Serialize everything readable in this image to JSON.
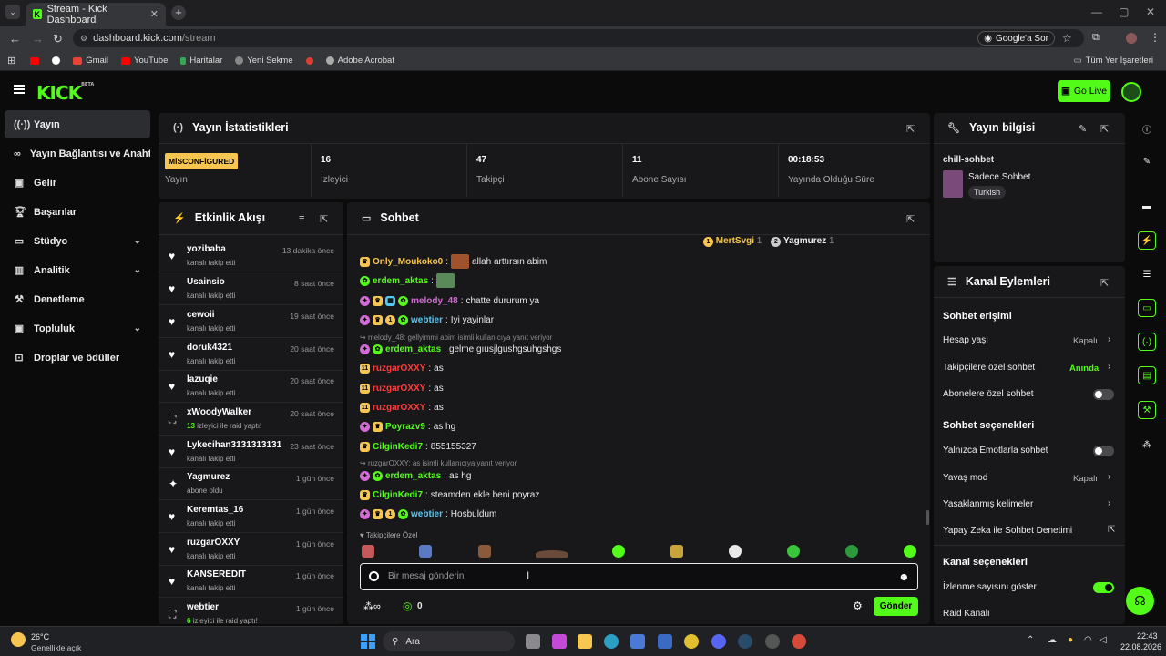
{
  "browser": {
    "tab_title": "Stream - Kick Dashboard",
    "url_host": "dashboard.kick.com",
    "url_path": "/stream",
    "google_sor": "Google'a Sor",
    "bookmarks": [
      "Gmail",
      "YouTube",
      "Haritalar",
      "Yeni Sekme",
      "Adobe Acrobat"
    ],
    "all_bookmarks": "Tüm Yer İşaretleri"
  },
  "header": {
    "logo": "KICK",
    "beta": "BETA",
    "go_live": "Go Live"
  },
  "sidebar": {
    "items": [
      {
        "label": "Yayın",
        "icon": "broadcast-icon"
      },
      {
        "label": "Yayın Bağlantısı ve Anahtarı",
        "icon": "link-icon"
      },
      {
        "label": "Gelir",
        "icon": "revenue-icon"
      },
      {
        "label": "Başarılar",
        "icon": "trophy-icon"
      },
      {
        "label": "Stüdyo",
        "icon": "studio-icon"
      },
      {
        "label": "Analitik",
        "icon": "analytics-icon"
      },
      {
        "label": "Denetleme",
        "icon": "moderation-icon"
      },
      {
        "label": "Topluluk",
        "icon": "community-icon"
      },
      {
        "label": "Droplar ve ödüller",
        "icon": "drops-icon"
      }
    ]
  },
  "stats": {
    "title": "Yayın İstatistikleri",
    "status_badge": "MİSCONFİGURED",
    "items": [
      {
        "label": "Yayın",
        "value": ""
      },
      {
        "label": "İzleyici",
        "value": "16"
      },
      {
        "label": "Takipçi",
        "value": "47"
      },
      {
        "label": "Abone Sayısı",
        "value": "11"
      },
      {
        "label": "Yayında Olduğu Süre",
        "value": "00:18:53"
      }
    ]
  },
  "activity": {
    "title": "Etkinlik Akışı",
    "rows": [
      {
        "name": "yozibaba",
        "sub": "kanalı takip etti",
        "time": "13 dakika önce",
        "icon": "heart-icon"
      },
      {
        "name": "Usainsio",
        "sub": "kanalı takip etti",
        "time": "8 saat önce",
        "icon": "heart-icon"
      },
      {
        "name": "cewoii",
        "sub": "kanalı takip etti",
        "time": "19 saat önce",
        "icon": "heart-icon"
      },
      {
        "name": "doruk4321",
        "sub": "kanalı takip etti",
        "time": "20 saat önce",
        "icon": "heart-icon"
      },
      {
        "name": "lazuqie",
        "sub": "kanalı takip etti",
        "time": "20 saat önce",
        "icon": "heart-icon"
      },
      {
        "name": "xWoodyWalker",
        "sub_count": "13",
        "sub": "izleyici ile raid yaptı!",
        "time": "20 saat önce",
        "icon": "raid-icon"
      },
      {
        "name": "Lykecihan3131313131",
        "sub": "kanalı takip etti",
        "time": "23 saat önce",
        "icon": "heart-icon"
      },
      {
        "name": "Yagmurez",
        "sub": "abone oldu",
        "time": "1 gün önce",
        "icon": "sparkle-icon"
      },
      {
        "name": "Keremtas_16",
        "sub": "kanalı takip etti",
        "time": "1 gün önce",
        "icon": "heart-icon"
      },
      {
        "name": "ruzgarOXXY",
        "sub": "kanalı takip etti",
        "time": "1 gün önce",
        "icon": "heart-icon"
      },
      {
        "name": "KANSEREDIT",
        "sub": "kanalı takip etti",
        "time": "1 gün önce",
        "icon": "heart-icon"
      },
      {
        "name": "webtier",
        "sub_count": "6",
        "sub": "izleyici ile raid yaptı!",
        "time": "1 gün önce",
        "icon": "raid-icon"
      }
    ]
  },
  "chat": {
    "title": "Sohbet",
    "mods": [
      {
        "name": "MertSvgi",
        "count": "1"
      },
      {
        "name": "Yagmurez",
        "count": "1"
      }
    ],
    "messages": [
      {
        "user": "Only_Moukoko0",
        "color": "#f7c650",
        "text": "allah arttırsın abim"
      },
      {
        "user": "erdem_aktas",
        "color": "#53fc18",
        "text": ""
      },
      {
        "user": "melody_48",
        "color": "#d46bd6",
        "text": "chatte dururum ya"
      },
      {
        "user": "webtier",
        "color": "#56c8f0",
        "text": "Iyi yayinlar"
      },
      {
        "reply": "melody_48: gellyimmi abim isimli kullanıcıya yanıt veriyor"
      },
      {
        "user": "erdem_aktas",
        "color": "#53fc18",
        "text": "gelme gıusjlgushgsuhgshgs"
      },
      {
        "user": "ruzgarOXXY",
        "color": "#ff3b3b",
        "text": "as"
      },
      {
        "user": "ruzgarOXXY",
        "color": "#ff3b3b",
        "text": "as"
      },
      {
        "user": "ruzgarOXXY",
        "color": "#ff3b3b",
        "text": "as"
      },
      {
        "user": "Poyrazv9",
        "color": "#53fc18",
        "text": "as hg"
      },
      {
        "user": "CilginKedi7",
        "color": "#53fc18",
        "text": "855155327"
      },
      {
        "reply": "ruzgarOXXY: as isimli kullanıcıya yanıt veriyor"
      },
      {
        "user": "erdem_aktas",
        "color": "#53fc18",
        "text": "as hg"
      },
      {
        "user": "CilginKedi7",
        "color": "#53fc18",
        "text": "steamden ekle beni poyraz"
      },
      {
        "user": "webtier",
        "color": "#56c8f0",
        "text": "Hosbuldum"
      }
    ],
    "followers_only": "Takipçilere Özel",
    "input_placeholder": "Bir mesaj gönderin",
    "points": "0",
    "send": "Gönder"
  },
  "stream_info": {
    "title": "Yayın bilgisi",
    "stream_title": "chill-sohbet",
    "category": "Sadece Sohbet",
    "language": "Turkish"
  },
  "channel_actions": {
    "title": "Kanal Eylemleri",
    "section_chat_access": "Sohbet erişimi",
    "account_age": "Hesap yaşı",
    "account_age_val": "Kapalı",
    "followers_only": "Takipçilere özel sohbet",
    "followers_only_val": "Anında",
    "subs_only": "Abonelere özel sohbet",
    "section_chat_options": "Sohbet seçenekleri",
    "emotes_only": "Yalnızca Emotlarla sohbet",
    "slow_mode": "Yavaş mod",
    "slow_mode_val": "Kapalı",
    "banned_words": "Yasaklanmış kelimeler",
    "ai_moderation": "Yapay Zeka ile Sohbet Denetimi",
    "section_channel_options": "Kanal seçenekleri",
    "show_viewers": "İzlenme sayısını göster",
    "raid_channel": "Raid Kanalı"
  },
  "taskbar": {
    "weather_temp": "26°C",
    "weather_text": "Genellikle açık",
    "search": "Ara",
    "time": "22:43",
    "date": "22.08.2026"
  },
  "colors": {
    "accent": "#53fc18",
    "badge_yellow": "#f7c650",
    "panel": "#18181b"
  }
}
